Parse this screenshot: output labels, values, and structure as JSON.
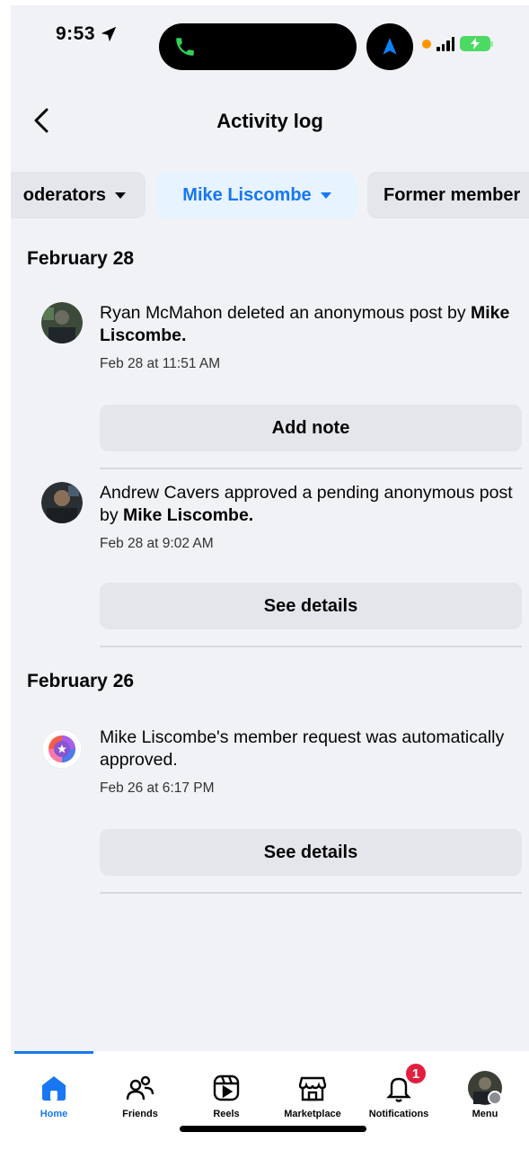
{
  "status_bar": {
    "time": "9:53"
  },
  "header": {
    "title": "Activity log"
  },
  "filters": [
    {
      "label": "oderators"
    },
    {
      "label": "Mike Liscombe"
    },
    {
      "label": "Former member"
    }
  ],
  "sections": [
    {
      "date": "February 28",
      "entries": [
        {
          "actor": "Ryan McMahon",
          "action": " deleted an anonymous post by ",
          "target": "Mike Liscombe.",
          "time": "Feb 28 at 11:51 AM",
          "button": "Add note"
        },
        {
          "actor": "Andrew Cavers",
          "action": " approved a pending anonymous post by ",
          "target": "Mike Liscombe.",
          "time": "Feb 28 at 9:02 AM",
          "button": "See details"
        }
      ]
    },
    {
      "date": "February 26",
      "entries": [
        {
          "actor": "Mike Liscombe's",
          "action": " member request was automatically approved.",
          "target": "",
          "time": "Feb 26 at 6:17 PM",
          "button": "See details"
        }
      ]
    }
  ],
  "bottom_nav": {
    "items": [
      {
        "label": "Home",
        "icon": "home-icon",
        "active": true
      },
      {
        "label": "Friends",
        "icon": "friends-icon"
      },
      {
        "label": "Reels",
        "icon": "reels-icon"
      },
      {
        "label": "Marketplace",
        "icon": "marketplace-icon"
      },
      {
        "label": "Notifications",
        "icon": "bell-icon",
        "badge": "1"
      },
      {
        "label": "Menu",
        "icon": "profile-avatar"
      }
    ]
  },
  "colors": {
    "accent": "#1877f2",
    "background": "#f0f2f5",
    "button": "#e4e6eb",
    "badge": "#e41e3f"
  }
}
